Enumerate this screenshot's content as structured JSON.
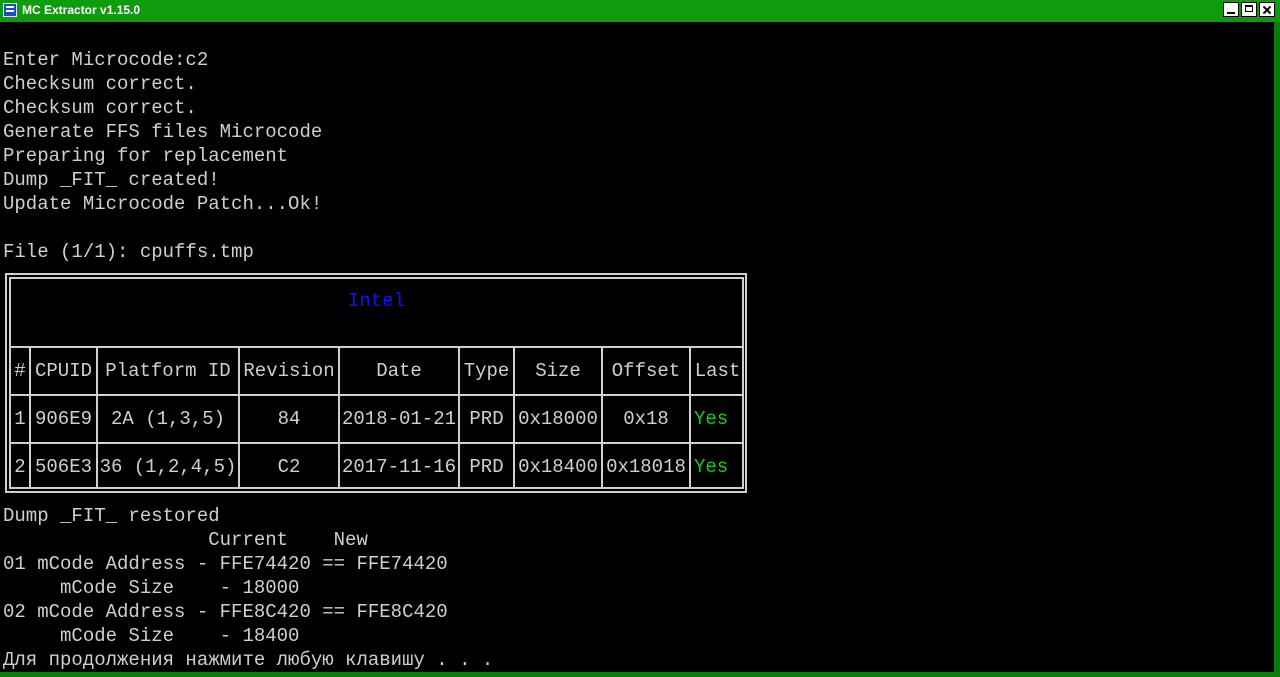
{
  "window": {
    "title": "MC Extractor v1.15.0",
    "controls": [
      "minimize",
      "maximize",
      "close"
    ]
  },
  "console": {
    "top_lines": [
      "Enter Microcode:c2",
      "Checksum correct.",
      "Checksum correct.",
      "Generate FFS files Microcode",
      "Preparing for replacement",
      "Dump _FIT_ created!",
      "Update Microcode Patch...Ok!",
      "",
      "File (1/1): cpuffs.tmp"
    ],
    "table": {
      "vendor": "Intel",
      "headers": [
        "#",
        "CPUID",
        "Platform ID",
        "Revision",
        "Date",
        "Type",
        "Size",
        "Offset",
        "Last"
      ],
      "rows": [
        [
          "1",
          "906E9",
          "2A (1,3,5)",
          "84",
          "2018-01-21",
          "PRD",
          "0x18000",
          "0x18",
          "Yes"
        ],
        [
          "2",
          "506E3",
          "36 (1,2,4,5)",
          "C2",
          "2017-11-16",
          "PRD",
          "0x18400",
          "0x18018",
          "Yes"
        ]
      ]
    },
    "bottom_lines": [
      "Dump _FIT_ restored",
      "                  Current    New",
      "01 mCode Address - FFE74420 == FFE74420",
      "     mCode Size    - 18000",
      "02 mCode Address - FFE8C420 == FFE8C420",
      "     mCode Size    - 18400",
      "Для продолжения нажмите любую клавишу . . ."
    ]
  },
  "colors": {
    "frame": "#0a7d0a",
    "titlebar": "#0e9b0e",
    "console_bg": "#000000",
    "console_text": "#cfcfcf",
    "vendor_text": "#1010ff",
    "yes_text": "#10d010"
  }
}
